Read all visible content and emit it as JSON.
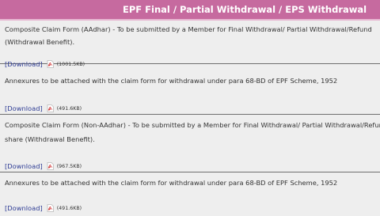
{
  "header": {
    "title": "EPF Final / Partial Withdrawal / EPS Withdrawal"
  },
  "documents": [
    {
      "lines": [
        "Composite Claim Form (AAdhar) - To be submitted by a Member for Final Withdrawal/ Partial Withdrawal/Refund",
        "(Withdrawal Benefit)."
      ],
      "link_label": "[Download]",
      "size": "(1001.5KB)"
    },
    {
      "lines": [
        "Annexures to be attached with the claim form for withdrawal under para 68-BD of EPF Scheme, 1952"
      ],
      "link_label": "[Download]",
      "size": "(491.6KB)"
    },
    {
      "lines": [
        "Composite Claim Form (Non-AAdhar) - To be submitted by a Member for Final Withdrawal/ Partial Withdrawal/Refund of",
        "share (Withdrawal Benefit)."
      ],
      "link_label": "[Download]",
      "size": "(967.5KB)"
    },
    {
      "lines": [
        "Annexures to be attached with the claim form for withdrawal under para 68-BD of EPF Scheme, 1952"
      ],
      "link_label": "[Download]",
      "size": "(491.6KB)"
    }
  ]
}
